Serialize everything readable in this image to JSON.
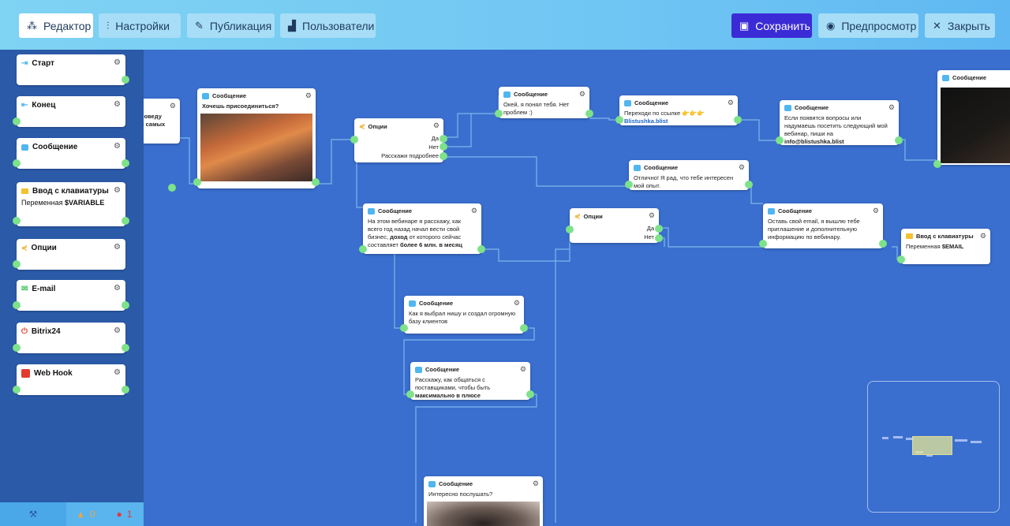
{
  "toolbar": {
    "editor_label": "Редактор",
    "settings_label": "Настройки",
    "publish_label": "Публикация",
    "users_label": "Пользователи",
    "save_label": "Сохранить",
    "preview_label": "Предпросмотр",
    "close_label": "Закрыть"
  },
  "palette": {
    "start": "Старт",
    "end": "Конец",
    "message": "Сообщение",
    "keyboard_input": "Ввод с клавиатуры",
    "keyboard_var_prefix": "Переменная",
    "keyboard_var": "$VARIABLE",
    "options": "Опции",
    "email": "E-mail",
    "bitrix": "Bitrix24",
    "webhook": "Web Hook"
  },
  "status": {
    "warnings": "0",
    "errors": "1"
  },
  "nodes": {
    "partial": {
      "line1": "роведу",
      "line2": "о самых"
    },
    "n1": {
      "title": "Сообщение",
      "text": "Хочешь присоединиться?"
    },
    "n2": {
      "title": "Опции",
      "opt1": "Да",
      "opt2": "Нет",
      "opt3": "Расскажи подробнее"
    },
    "n3": {
      "title": "Сообщение",
      "text": "Окей, я понял тебя. Нет проблем :)"
    },
    "n4": {
      "title": "Сообщение",
      "text": "Переходи по ссылке",
      "emoji": "👉👉👉",
      "link": "Blistushka.blist"
    },
    "n5": {
      "title": "Сообщение",
      "text": "Если появятся вопросы или надумаешь посетить следующий мой вебинар, пиши на",
      "email": "info@blistushka.blist"
    },
    "n6": {
      "title": "Сообщение"
    },
    "n7": {
      "title": "Сообщение",
      "text": "Отлично! Я рад, что тебе интересен мой опыт."
    },
    "n8": {
      "title": "Сообщение",
      "text1": "На этом вебинаре я расскажу, как всего год назад начал вести свой бизнес,",
      "bold1": "доход",
      "text2": "от которого сейчас составляет",
      "bold2": "более 6 млн. в месяц"
    },
    "n9": {
      "title": "Опции",
      "opt1": "Да",
      "opt2": "Нет"
    },
    "n10": {
      "title": "Сообщение",
      "text": "Оставь свой email, я вышлю тебе приглашение и дополнительную информацию по вебинару."
    },
    "n11": {
      "title": "Ввод с клавиатуры",
      "prefix": "Переменная",
      "var": "$EMAIL"
    },
    "n12": {
      "title": "Сообщение",
      "text": "Как я выбрал нишу и создал огромную базу клиентов"
    },
    "n13": {
      "title": "Сообщение",
      "text": "Расскажу, как общаться с поставщиками, чтобы быть",
      "bold": "максимально в плюсе"
    },
    "n14": {
      "title": "Сообщение",
      "text": "Интересно послушать?"
    }
  }
}
